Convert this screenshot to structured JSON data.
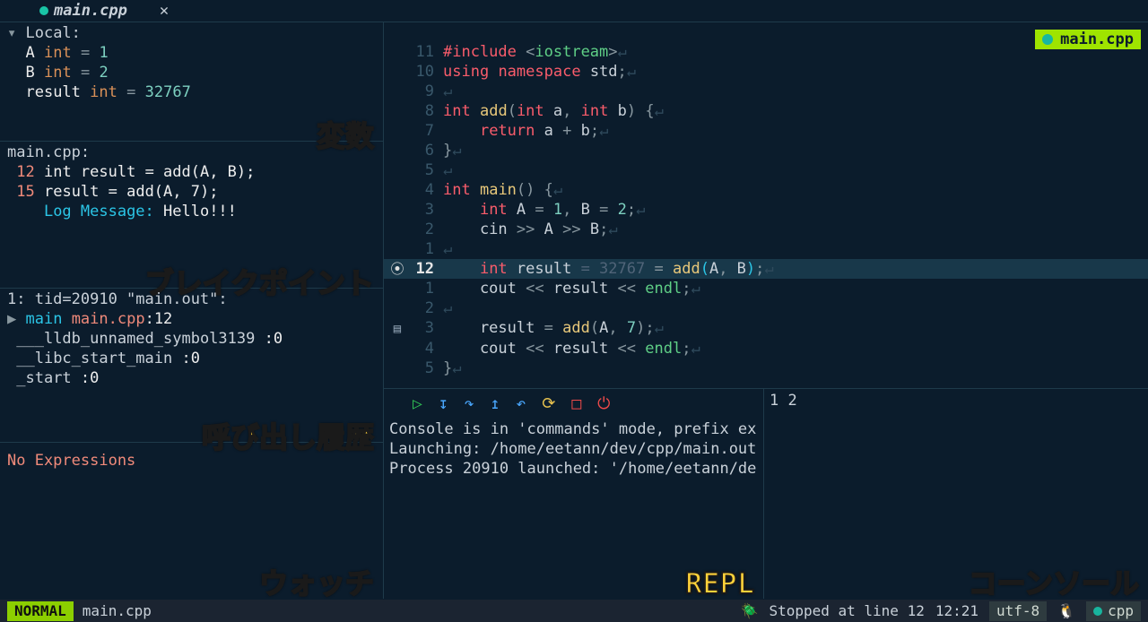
{
  "tabbar": {
    "file": "main.cpp"
  },
  "sidebar": {
    "vars": {
      "scope": "Local:",
      "list": [
        {
          "name": "A",
          "type": "int",
          "eq": "=",
          "val": "1"
        },
        {
          "name": "B",
          "type": "int",
          "eq": "=",
          "val": "2"
        },
        {
          "name": "result",
          "type": "int",
          "eq": "=",
          "val": "32767"
        }
      ]
    },
    "breakpoints": {
      "file": "main.cpp:",
      "items": [
        {
          "line": "12",
          "code": "int result = add(A, B);"
        },
        {
          "line": "15",
          "code": "result = add(A, 7);"
        }
      ],
      "log_label": "Log Message: ",
      "log_msg": "Hello!!!"
    },
    "stack": {
      "header": "1: tid=20910 \"main.out\":",
      "frames": [
        {
          "marker": "▶",
          "fn": "main",
          "loc": "main.cpp",
          "line": ":12"
        },
        {
          "fn": "___lldb_unnamed_symbol3139 ",
          "loc": ":0"
        },
        {
          "fn": "__libc_start_main ",
          "loc": ":0"
        },
        {
          "fn": "_start ",
          "loc": ":0"
        }
      ]
    },
    "watch": {
      "empty": "No Expressions"
    }
  },
  "editor": {
    "badge": "main.cpp",
    "lines": [
      {
        "sign": "",
        "n": "11",
        "html": "<span class='c-red'>#include</span> <span class='c-punct'>&lt;</span><span class='c-green'>iostream</span><span class='c-punct'>&gt;</span>"
      },
      {
        "sign": "",
        "n": "10",
        "html": "<span class='c-red'>using</span> <span class='c-red'>namespace</span> <span class='c-ident'>std</span><span class='c-punct'>;</span>"
      },
      {
        "sign": "",
        "n": "9",
        "html": ""
      },
      {
        "sign": "",
        "n": "8",
        "html": "<span class='c-red'>int</span> <span class='c-yellow'>add</span><span class='c-punct'>(</span><span class='c-red'>int</span> a<span class='c-punct'>,</span> <span class='c-red'>int</span> b<span class='c-punct'>)</span> <span class='c-punct'>{</span>"
      },
      {
        "sign": "",
        "n": "7",
        "html": "    <span class='c-red'>return</span> a <span class='c-punct'>+</span> b<span class='c-punct'>;</span>"
      },
      {
        "sign": "",
        "n": "6",
        "html": "<span class='c-punct'>}</span>"
      },
      {
        "sign": "",
        "n": "5",
        "html": ""
      },
      {
        "sign": "",
        "n": "4",
        "html": "<span class='c-red'>int</span> <span class='c-yellow'>main</span><span class='c-punct'>()</span> <span class='c-punct'>{</span>"
      },
      {
        "sign": "",
        "n": "3",
        "html": "    <span class='c-red'>int</span> A <span class='c-punct'>=</span> <span class='c-num'>1</span><span class='c-punct'>,</span> B <span class='c-punct'>=</span> <span class='c-num'>2</span><span class='c-punct'>;</span>"
      },
      {
        "sign": "",
        "n": "2",
        "html": "    cin <span class='c-punct'>&gt;&gt;</span> A <span class='c-punct'>&gt;&gt;</span> B<span class='c-punct'>;</span>"
      },
      {
        "sign": "",
        "n": "1",
        "html": ""
      },
      {
        "sign": "bp",
        "n": "12",
        "cur": true,
        "html": "    <span class='c-red'>int</span> result <span class='c-cmt'>= 32767</span> <span class='c-punct'>=</span> <span class='c-yellow'>add</span><span class='c-cyan'>(</span>A<span class='c-punct'>,</span> B<span class='c-cyan'>)</span><span class='c-punct'>;</span>"
      },
      {
        "sign": "",
        "n": "1",
        "html": "    cout <span class='c-punct'>&lt;&lt;</span> result <span class='c-punct'>&lt;&lt;</span> <span class='c-green'>endl</span><span class='c-punct'>;</span>"
      },
      {
        "sign": "",
        "n": "2",
        "html": ""
      },
      {
        "sign": "lp",
        "n": "3",
        "html": "    result <span class='c-punct'>=</span> <span class='c-yellow'>add</span><span class='c-punct'>(</span>A<span class='c-punct'>,</span> <span class='c-num'>7</span><span class='c-punct'>)</span><span class='c-punct'>;</span>"
      },
      {
        "sign": "",
        "n": "4",
        "html": "    cout <span class='c-punct'>&lt;&lt;</span> result <span class='c-punct'>&lt;&lt;</span> <span class='c-green'>endl</span><span class='c-punct'>;</span>"
      },
      {
        "sign": "",
        "n": "5",
        "html": "<span class='c-punct'>}</span>"
      }
    ]
  },
  "repl": {
    "lines": [
      "Console is in 'commands' mode, prefix ex",
      "Launching: /home/eetann/dev/cpp/main.out",
      "Process 20910 launched: '/home/eetann/de"
    ]
  },
  "console": {
    "text": "1 2"
  },
  "status": {
    "mode": "NORMAL",
    "file": "main.cpp",
    "stopped": "Stopped at line 12",
    "pos": "12:21",
    "enc": "utf-8",
    "ft": "cpp"
  },
  "annotations": {
    "vars": "変数",
    "bp": "ブレイクポイント",
    "stack": "呼び出し履歴",
    "watch": "ウォッチ",
    "repl": "REPL",
    "console": "コーンソール"
  }
}
